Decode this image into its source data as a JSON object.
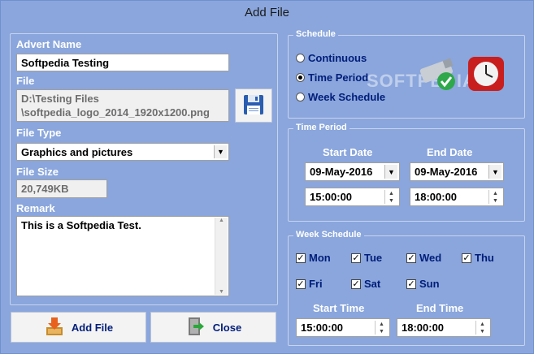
{
  "window": {
    "title": "Add File"
  },
  "advert": {
    "label": "Advert Name",
    "value": "Softpedia Testing"
  },
  "file": {
    "label": "File",
    "line1": "D:\\Testing Files",
    "line2": "\\softpedia_logo_2014_1920x1200.png"
  },
  "file_type": {
    "label": "File Type",
    "value": "Graphics and pictures"
  },
  "file_size": {
    "label": "File Size",
    "value": "20,749KB"
  },
  "remark": {
    "label": "Remark",
    "value": "This is a Softpedia Test."
  },
  "buttons": {
    "add_file": "Add File",
    "close": "Close"
  },
  "schedule": {
    "title": "Schedule",
    "options": [
      "Continuous",
      "Time Period",
      "Week Schedule"
    ],
    "selected": "Time Period"
  },
  "watermark": "SOFTPEDIA",
  "time_period": {
    "title": "Time Period",
    "start_date_label": "Start Date",
    "end_date_label": "End Date",
    "start_date": "09-May-2016",
    "end_date": "09-May-2016",
    "start_time": "15:00:00",
    "end_time": "18:00:00"
  },
  "week_schedule": {
    "title": "Week Schedule",
    "days": [
      "Mon",
      "Tue",
      "Wed",
      "Thu",
      "Fri",
      "Sat",
      "Sun"
    ],
    "start_time_label": "Start Time",
    "end_time_label": "End Time",
    "start_time": "15:00:00",
    "end_time": "18:00:00"
  }
}
